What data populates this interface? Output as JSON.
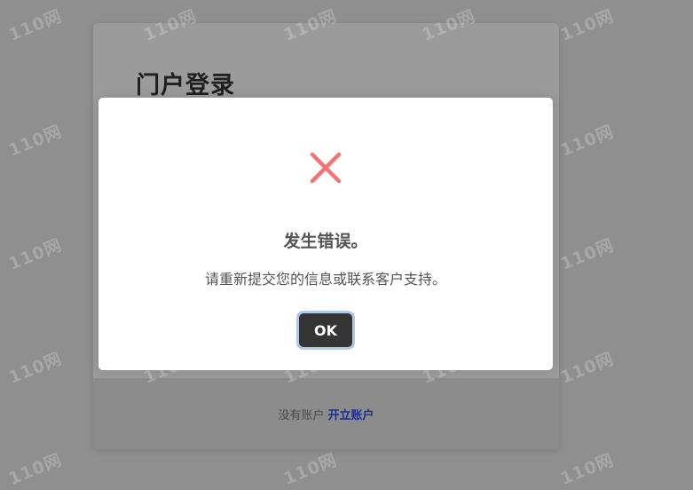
{
  "login": {
    "title": "门户登录",
    "footer_text": "没有账户",
    "footer_link": "开立账户"
  },
  "watermark": {
    "text": "110网"
  },
  "modal": {
    "icon": "error-x-icon",
    "icon_color": "#f27474",
    "title": "发生错误。",
    "message": "请重新提交您的信息或联系客户支持。",
    "ok_label": "OK"
  }
}
